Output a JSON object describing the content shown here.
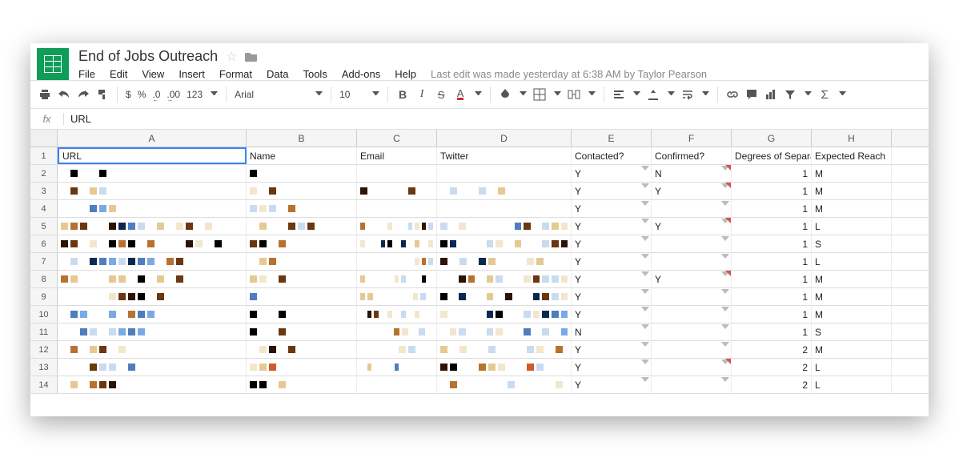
{
  "doc": {
    "title": "End of Jobs Outreach"
  },
  "menu": {
    "file": "File",
    "edit": "Edit",
    "view": "View",
    "insert": "Insert",
    "format": "Format",
    "data": "Data",
    "tools": "Tools",
    "addons": "Add-ons",
    "help": "Help",
    "last_edit": "Last edit was made yesterday at 6:38 AM by Taylor Pearson"
  },
  "toolbar": {
    "currency": "$",
    "percent": "%",
    "dec_dec": ".0",
    "inc_dec": ".00",
    "num_fmt": "123",
    "font": "Arial",
    "font_size": "10"
  },
  "formula": {
    "label": "fx",
    "value": "URL"
  },
  "columns": {
    "A": "A",
    "B": "B",
    "C": "C",
    "D": "D",
    "E": "E",
    "F": "F",
    "G": "G",
    "H": "H"
  },
  "headers": {
    "url": "URL",
    "name": "Name",
    "email": "Email",
    "twitter": "Twitter",
    "contacted": "Contacted?",
    "confirmed": "Confirmed?",
    "degrees": "Degrees of Separation",
    "expected": "Expected Reach"
  },
  "pixel_palette": [
    "#0b294f",
    "#4f7dbd",
    "#7aa9e6",
    "#c9dbef",
    "#f2e7cd",
    "#e6c992",
    "#b8722f",
    "#6a3710",
    "#2b1403",
    "#000000",
    "#ffffff",
    "#d05a2b"
  ],
  "pixel_rows": {
    "2": {
      "A": [
        10,
        9,
        10,
        10,
        9
      ],
      "B": [
        9
      ],
      "C": [],
      "D": []
    },
    "3": {
      "A": [
        10,
        7,
        10,
        5,
        3
      ],
      "B": [
        4,
        10,
        7
      ],
      "C": [
        8,
        10,
        10,
        10,
        10,
        7
      ],
      "D": [
        10,
        3,
        10,
        10,
        3,
        10,
        5
      ]
    },
    "4": {
      "A": [
        10,
        10,
        10,
        1,
        2,
        5,
        10,
        10
      ],
      "B": [
        3,
        4,
        3,
        10,
        6
      ],
      "C": [],
      "D": []
    },
    "5": {
      "A": [
        5,
        6,
        7,
        10,
        10,
        8,
        0,
        1,
        3,
        10,
        5,
        10,
        4,
        7,
        10,
        4
      ],
      "B": [
        10,
        5,
        10,
        10,
        7,
        3,
        7
      ],
      "C": [
        6,
        10,
        10,
        10,
        4,
        10,
        10,
        3,
        4,
        8,
        3
      ],
      "D": [
        3,
        10,
        4,
        10,
        10,
        10,
        10,
        10,
        1,
        7,
        10,
        3,
        5,
        4
      ]
    },
    "6": {
      "A": [
        8,
        7,
        10,
        4,
        10,
        9,
        6,
        9,
        10,
        6,
        10,
        10,
        10,
        8,
        4,
        10,
        9,
        10
      ],
      "B": [
        7,
        9,
        10,
        6
      ],
      "C": [
        4,
        10,
        10,
        0,
        9,
        10,
        0,
        10,
        5,
        10,
        4
      ],
      "D": [
        9,
        0,
        10,
        10,
        10,
        3,
        4,
        10,
        5,
        10,
        10,
        3,
        7,
        8
      ]
    },
    "7": {
      "A": [
        10,
        3,
        10,
        0,
        1,
        2,
        3,
        0,
        1,
        2,
        10,
        6,
        7
      ],
      "B": [
        10,
        5,
        6,
        10,
        10
      ],
      "C": [
        10,
        10,
        10,
        10,
        10,
        10,
        10,
        10,
        4,
        6,
        3
      ],
      "D": [
        8,
        10,
        3,
        10,
        0,
        5,
        10,
        10,
        10,
        4,
        5,
        10
      ]
    },
    "8": {
      "A": [
        6,
        5,
        10,
        10,
        10,
        5,
        5,
        10,
        9,
        10,
        5,
        10,
        7,
        10
      ],
      "B": [
        5,
        4,
        10,
        7
      ],
      "C": [
        5,
        10,
        10,
        10,
        10,
        4,
        3,
        10,
        10,
        9,
        10
      ],
      "D": [
        10,
        10,
        8,
        6,
        10,
        5,
        3,
        10,
        10,
        4,
        7,
        3,
        3,
        4
      ]
    },
    "9": {
      "A": [
        10,
        10,
        10,
        10,
        10,
        4,
        7,
        8,
        9,
        10,
        7,
        10,
        10
      ],
      "B": [
        1,
        10
      ],
      "C": [
        5,
        5,
        10,
        10,
        10,
        10,
        10,
        4,
        3,
        10
      ],
      "D": [
        9,
        10,
        0,
        10,
        10,
        5,
        10,
        8,
        10,
        10,
        0,
        7,
        3,
        4
      ]
    },
    "10": {
      "A": [
        10,
        1,
        2,
        10,
        10,
        2,
        10,
        6,
        1,
        2
      ],
      "B": [
        9,
        10,
        10,
        9,
        10
      ],
      "C": [
        10,
        8,
        7,
        10,
        4,
        10,
        3,
        10,
        4,
        10,
        10
      ],
      "D": [
        4,
        10,
        10,
        10,
        10,
        0,
        9,
        10,
        10,
        3,
        4,
        0,
        1,
        2
      ]
    },
    "11": {
      "A": [
        10,
        10,
        1,
        3,
        10,
        3,
        2,
        1,
        2
      ],
      "B": [
        9,
        10,
        10,
        7
      ],
      "C": [
        10,
        10,
        10,
        10,
        6,
        4,
        10,
        3,
        10
      ],
      "D": [
        10,
        4,
        3,
        10,
        10,
        3,
        4,
        10,
        10,
        1,
        10,
        3,
        10,
        2
      ]
    },
    "12": {
      "A": [
        10,
        6,
        10,
        5,
        7,
        10,
        4,
        10
      ],
      "B": [
        10,
        4,
        8,
        10,
        7
      ],
      "C": [
        10,
        10,
        10,
        10,
        4,
        3,
        10
      ],
      "D": [
        5,
        10,
        4,
        10,
        10,
        3,
        10,
        10,
        10,
        3,
        4,
        10,
        6
      ]
    },
    "13": {
      "A": [
        10,
        10,
        10,
        7,
        3,
        3,
        10,
        1,
        10
      ],
      "B": [
        4,
        5,
        11
      ],
      "C": [
        10,
        5,
        10,
        10,
        10,
        1,
        10,
        10,
        10,
        10,
        10
      ],
      "D": [
        8,
        9,
        10,
        10,
        6,
        5,
        4,
        10,
        10,
        11,
        3
      ]
    },
    "14": {
      "A": [
        10,
        5,
        10,
        6,
        7,
        8,
        10
      ],
      "B": [
        9,
        9,
        10,
        5,
        10,
        10
      ],
      "C": [],
      "D": [
        10,
        6,
        10,
        10,
        10,
        10,
        10,
        3,
        10,
        10,
        10,
        10,
        4
      ]
    }
  },
  "chart_data": {
    "type": "table",
    "columns": [
      "URL",
      "Name",
      "Email",
      "Twitter",
      "Contacted?",
      "Confirmed?",
      "Degrees of Separation",
      "Expected Reach"
    ],
    "rows": [
      {
        "contacted": "Y",
        "confirmed": "N",
        "degrees": 1,
        "expected": "M"
      },
      {
        "contacted": "Y",
        "confirmed": "Y",
        "degrees": 1,
        "expected": "M"
      },
      {
        "contacted": "Y",
        "confirmed": "",
        "degrees": 1,
        "expected": "M"
      },
      {
        "contacted": "Y",
        "confirmed": "Y",
        "degrees": 1,
        "expected": "L"
      },
      {
        "contacted": "Y",
        "confirmed": "",
        "degrees": 1,
        "expected": "S"
      },
      {
        "contacted": "Y",
        "confirmed": "",
        "degrees": 1,
        "expected": "L"
      },
      {
        "contacted": "Y",
        "confirmed": "Y",
        "degrees": 1,
        "expected": "M"
      },
      {
        "contacted": "Y",
        "confirmed": "",
        "degrees": 1,
        "expected": "M"
      },
      {
        "contacted": "Y",
        "confirmed": "",
        "degrees": 1,
        "expected": "M"
      },
      {
        "contacted": "N",
        "confirmed": "",
        "degrees": 1,
        "expected": "S"
      },
      {
        "contacted": "Y",
        "confirmed": "",
        "degrees": 2,
        "expected": "M"
      },
      {
        "contacted": "Y",
        "confirmed": "",
        "degrees": 2,
        "expected": "L"
      },
      {
        "contacted": "Y",
        "confirmed": "",
        "degrees": 2,
        "expected": "L"
      }
    ]
  }
}
